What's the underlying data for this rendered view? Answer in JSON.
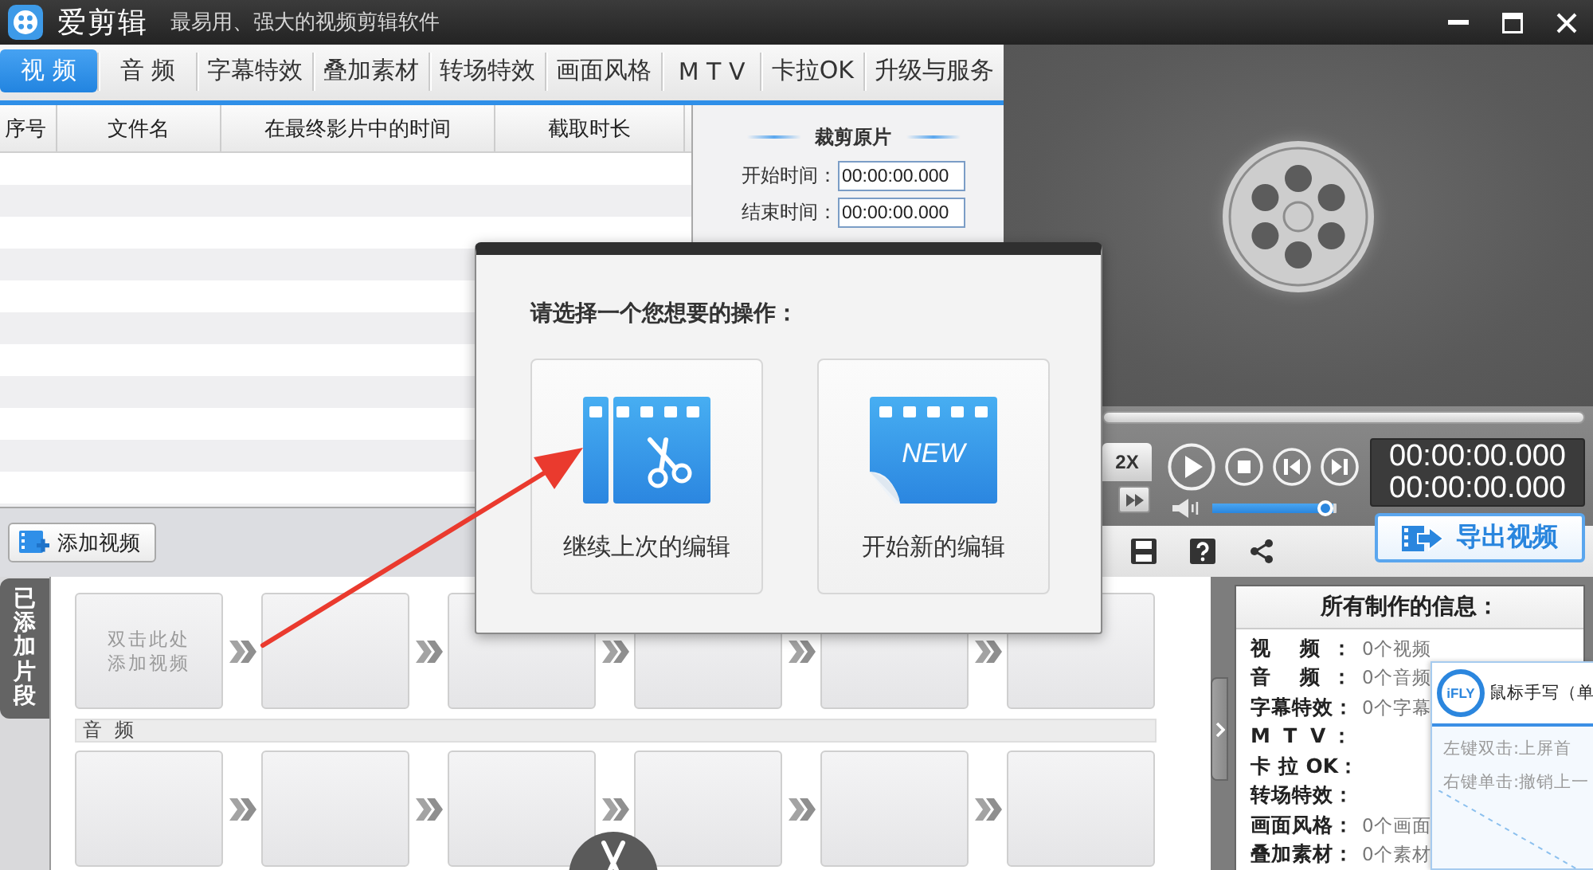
{
  "window": {
    "title": "爱剪辑",
    "subtitle": "最易用、强大的视频剪辑软件"
  },
  "tabs": [
    {
      "label": "视 频",
      "selected": true
    },
    {
      "label": "音 频",
      "selected": false
    },
    {
      "label": "字幕特效",
      "selected": false
    },
    {
      "label": "叠加素材",
      "selected": false
    },
    {
      "label": "转场特效",
      "selected": false
    },
    {
      "label": "画面风格",
      "selected": false
    },
    {
      "label": "M T V",
      "selected": false
    },
    {
      "label": "卡拉OK",
      "selected": false
    },
    {
      "label": "升级与服务",
      "selected": false
    }
  ],
  "table": {
    "columns": [
      "序号",
      "文件名",
      "在最终影片中的时间",
      "截取时长"
    ]
  },
  "crop_panel": {
    "title": "裁剪原片",
    "fields": [
      {
        "label": "开始时间：",
        "value": "00:00:00.000"
      },
      {
        "label": "结束时间：",
        "value": "00:00:00.000"
      }
    ]
  },
  "toolbar": {
    "add_video_button": "添加视频"
  },
  "player": {
    "speed_button": "2X",
    "times": [
      "00:00:00.000",
      "00:00:00.000"
    ],
    "volume": {
      "level": 0.97
    },
    "export_button": "导出视频"
  },
  "clips": {
    "side_tab": "已添加片段",
    "video_slots": [
      {
        "empty": true,
        "hint": "双击此处添加视频"
      },
      {
        "empty": true
      },
      {
        "empty": true
      },
      {
        "empty": true
      },
      {
        "empty": true
      },
      {
        "empty": true
      }
    ],
    "audio_label": "音 频",
    "audio_slots": [
      {
        "empty": true
      },
      {
        "empty": true
      },
      {
        "empty": true
      },
      {
        "empty": true
      },
      {
        "empty": true
      },
      {
        "empty": true
      }
    ]
  },
  "info_panel": {
    "title": "所有制作的信息：",
    "rows": [
      {
        "label": "视 频：",
        "value": "0个视频"
      },
      {
        "label": "音 频：",
        "value": "0个音频"
      },
      {
        "label": "字幕特效：",
        "value": "0个字幕"
      },
      {
        "label": "M T V："
      },
      {
        "label": "卡 拉 OK："
      },
      {
        "label": "转场特效："
      },
      {
        "label": "画面风格：",
        "value": "0个画面"
      },
      {
        "label": "叠加素材：",
        "value": "0个素材"
      }
    ]
  },
  "dialog": {
    "title": "请选择一个您想要的操作：",
    "options": [
      {
        "kind": "continue",
        "label": "继续上次的编辑"
      },
      {
        "kind": "new",
        "label": "开始新的编辑",
        "badge": "NEW"
      }
    ]
  },
  "handwriting_popup": {
    "logo": "iFLY",
    "title": "鼠标手写（单",
    "hints": [
      "左键双击:上屏首",
      "右键单击:撤销上一"
    ]
  }
}
